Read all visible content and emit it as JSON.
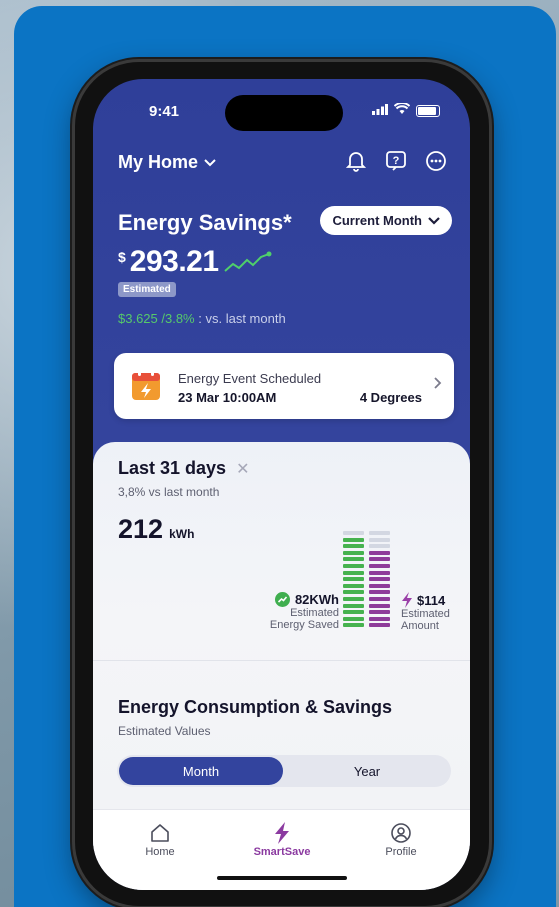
{
  "status": {
    "time": "9:41"
  },
  "header": {
    "home_label": "My Home"
  },
  "savings": {
    "title": "Energy Savings*",
    "period_button": "Current Month",
    "currency": "$",
    "amount": "293.21",
    "badge": "Estimated",
    "change": "$3.625 /3.8%",
    "change_suffix": ": vs. last month"
  },
  "event": {
    "title": "Energy Event Scheduled",
    "date": "23 Mar 10:00AM",
    "degrees": "4 Degrees"
  },
  "usage": {
    "title": "Last 31 days",
    "subtitle": "3,8% vs last month",
    "value": "212",
    "unit": "kWh",
    "saved_value": "82KWh",
    "saved_label_1": "Estimated",
    "saved_label_2": "Energy Saved",
    "amount_value": "$114",
    "amount_label_1": "Estimated",
    "amount_label_2": "Amount",
    "saved_color": "#46b24f",
    "amount_color": "#8e3c9a"
  },
  "consumption": {
    "title": "Energy Consumption & Savings",
    "subtitle": "Estimated Values",
    "toggle_month": "Month",
    "toggle_year": "Year"
  },
  "tabs": [
    {
      "label": "Home",
      "icon": "home-icon"
    },
    {
      "label": "SmartSave",
      "icon": "lightning-icon"
    },
    {
      "label": "Profile",
      "icon": "profile-icon"
    }
  ]
}
